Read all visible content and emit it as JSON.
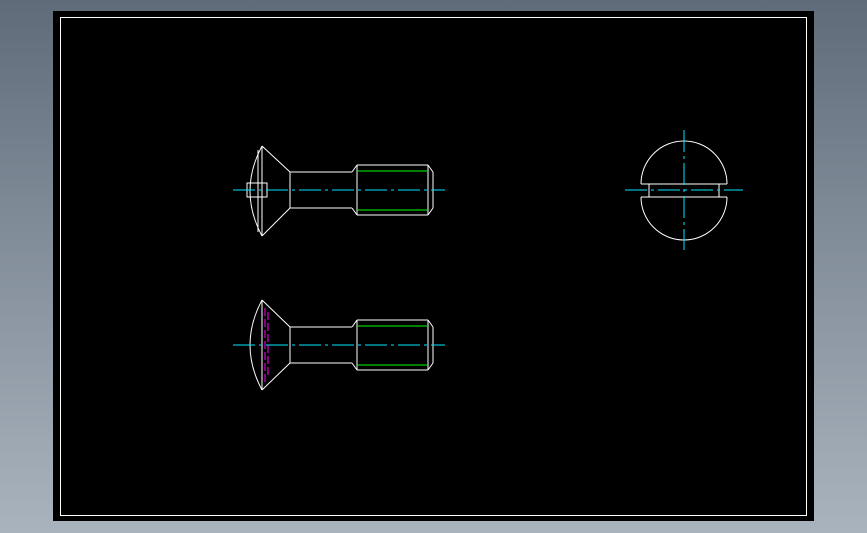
{
  "canvas": {
    "background_color": "#000000",
    "surround_gradient": [
      "#5f6b79",
      "#a9b3bd"
    ]
  },
  "layers": {
    "outline": "#ffffff",
    "centerline": "#00e5ff",
    "thread": "#00ff00",
    "hidden": "#ff00ff"
  },
  "drawing": {
    "views": [
      {
        "name": "front-section-view",
        "shows_slot": true
      },
      {
        "name": "front-elevation-view",
        "shows_slot": false
      },
      {
        "name": "end-view-slotted-head"
      }
    ]
  }
}
